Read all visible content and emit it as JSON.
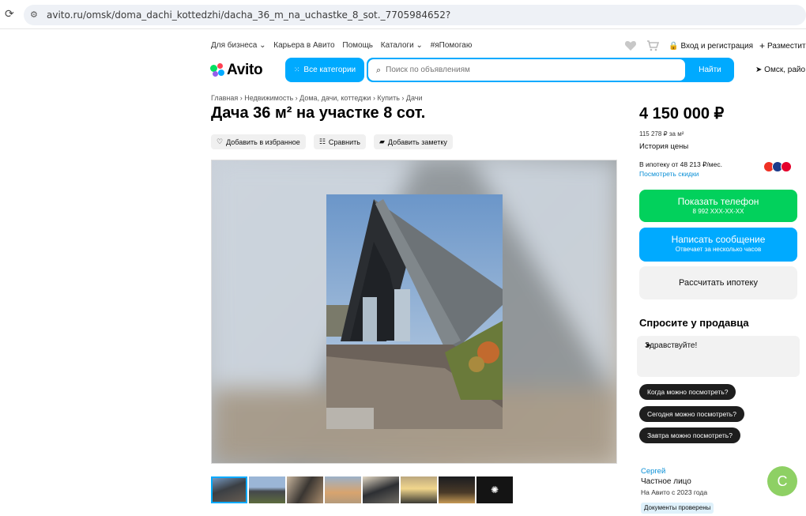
{
  "browser": {
    "url": "avito.ru/omsk/doma_dachi_kottedzhi/dacha_36_m_na_uchastke_8_sot._7705984652?"
  },
  "topnav": {
    "items": [
      "Для бизнеса ⌄",
      "Карьера в Авито",
      "Помощь",
      "Каталоги ⌄",
      "#яПомогаю"
    ],
    "login": "Вход и регистрация",
    "post": "Разместить"
  },
  "header": {
    "logo": "Avito",
    "all_categories": "Все категории",
    "search_placeholder": "Поиск по объявлениям",
    "search_button": "Найти",
    "location": "Омск, райо"
  },
  "listing": {
    "breadcrumbs": "Главная › Недвижимость › Дома, дачи, коттеджи › Купить › Дачи",
    "title": "Дача 36 м² на участке 8 сот.",
    "actions": {
      "favorite": "Добавить в избранное",
      "compare": "Сравнить",
      "note": "Добавить заметку"
    }
  },
  "sidebar": {
    "price": "4 150 000 ₽",
    "price_per_m2": "115 278 ₽ за м²",
    "price_history": "История цены",
    "mortgage": "В ипотеку от 48 213 ₽/мес.",
    "discounts": "Посмотреть скидки",
    "show_phone": "Показать телефон",
    "phone_masked": "8 992 XXX-XX-XX",
    "write_message": "Написать сообщение",
    "reply_time": "Отвечает за несколько часов",
    "calc_mortgage": "Рассчитать ипотеку",
    "ask_title": "Спросите у продавца",
    "ask_text": "Здравствуйте!",
    "quick_questions": [
      "Когда можно посмотреть?",
      "Сегодня можно посмотреть?",
      "Завтра можно посмотреть?"
    ]
  },
  "seller": {
    "name": "Сергей",
    "type": "Частное лицо",
    "since": "На Авито с 2023 года",
    "docs_badge": "Документы проверены",
    "avatar_letter": "С"
  },
  "colors": {
    "avito_blue": "#00aaff",
    "phone_green": "#02d15c",
    "avatar_green": "#8ed064"
  }
}
